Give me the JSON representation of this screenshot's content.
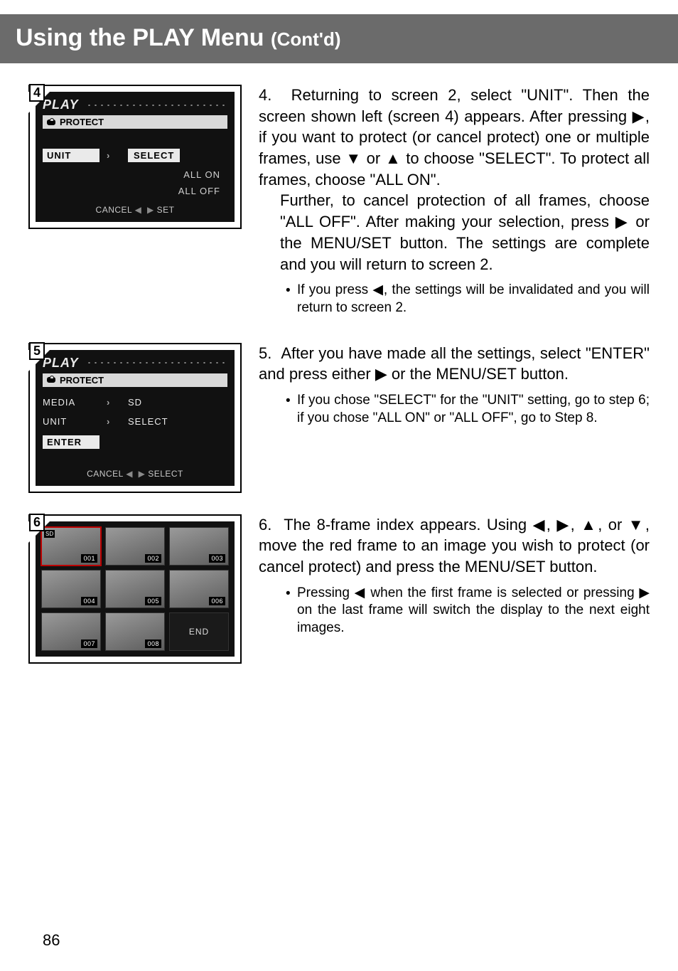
{
  "header": {
    "main": "Using the PLAY Menu ",
    "sub": "(Cont'd)"
  },
  "page_number": "86",
  "screens": {
    "s4": {
      "num": "4",
      "title": "PLAY",
      "protect_label": "PROTECT",
      "rows": [
        {
          "label": "UNIT",
          "value": "SELECT",
          "label_hi": true,
          "value_hi": true
        }
      ],
      "options": [
        "ALL ON",
        "ALL OFF"
      ],
      "footer": {
        "cancel": "CANCEL",
        "left": "◀",
        "right": "▶",
        "set": "SET"
      }
    },
    "s5": {
      "num": "5",
      "title": "PLAY",
      "protect_label": "PROTECT",
      "rows": [
        {
          "label": "MEDIA",
          "value": "SD"
        },
        {
          "label": "UNIT",
          "value": "SELECT"
        },
        {
          "label": "ENTER",
          "value": "",
          "label_hi": true
        }
      ],
      "footer": {
        "cancel": "CANCEL",
        "left": "◀",
        "right": "▶",
        "set": "SELECT"
      }
    },
    "s6": {
      "num": "6",
      "sd": "SD",
      "thumbs": [
        "001",
        "002",
        "003",
        "004",
        "005",
        "006",
        "007",
        "008"
      ],
      "end": "END"
    }
  },
  "steps": {
    "s4": {
      "num": "4.",
      "text_a": "Returning to screen 2, select \"UNIT\". Then the screen shown left (screen 4) appears. After pressing ▶, if you want to protect (or cancel protect) one or multiple frames, use ▼ or ▲ to choose \"SELECT\". To protect all frames, choose \"ALL ON\".",
      "text_b": "Further, to cancel protection of all frames, choose \"ALL OFF\". After making your selection, press ▶ or the MENU/SET button. The settings are complete and you will return to screen 2.",
      "bullets": [
        "If you press ◀, the settings will be invalidated and you will return to screen 2."
      ]
    },
    "s5": {
      "num": "5.",
      "text_a": "After you have made all the settings, select \"ENTER\" and press either ▶ or the MENU/SET button.",
      "bullets": [
        "If you chose \"SELECT\" for the \"UNIT\" setting, go to step 6; if you chose \"ALL ON\" or \"ALL OFF\", go to Step 8."
      ]
    },
    "s6": {
      "num": "6.",
      "text_a": "The 8-frame index appears. Using ◀, ▶, ▲, or ▼, move the red frame to an image you wish to protect (or cancel protect) and press the MENU/SET button.",
      "bullets": [
        "Pressing ◀ when the first frame is selected or pressing ▶ on the last frame will switch the display to the next eight images."
      ]
    }
  }
}
